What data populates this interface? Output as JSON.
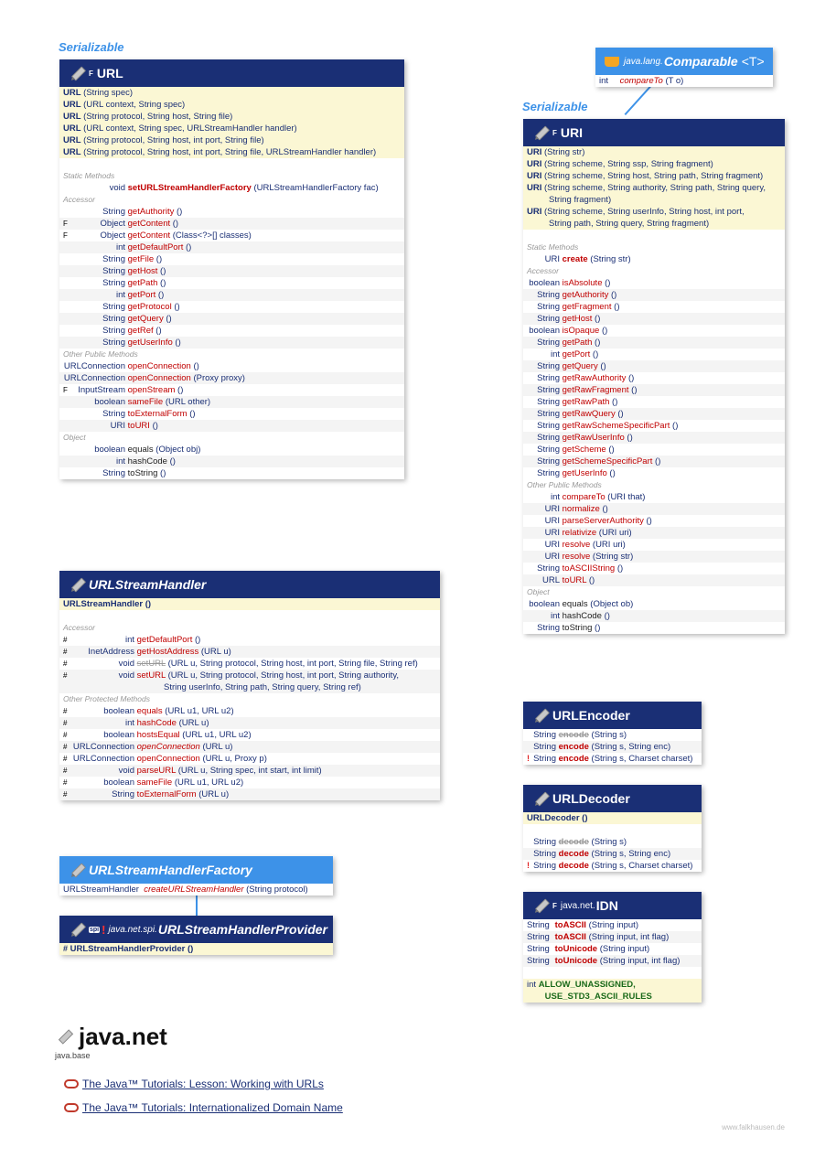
{
  "serializable_label": "Serializable",
  "url": {
    "mod": "F",
    "name": "URL",
    "ctors": [
      [
        "URL",
        "(String spec)"
      ],
      [
        "URL",
        "(URL context, String spec)"
      ],
      [
        "URL",
        "(String protocol, String host, String file)"
      ],
      [
        "URL",
        "(URL context, String spec, URLStreamHandler handler)"
      ],
      [
        "URL",
        "(String protocol, String host, int port, String file)"
      ],
      [
        "URL",
        "(String protocol, String host, int port, String file, URLStreamHandler handler)"
      ]
    ],
    "sections": [
      {
        "title": "Static Methods",
        "rows": [
          [
            "",
            "void",
            "setURLStreamHandlerFactory",
            "(URLStreamHandlerFactory fac)"
          ]
        ]
      },
      {
        "title": "Accessor",
        "rows": [
          [
            "",
            "String",
            "getAuthority",
            "()"
          ],
          [
            "F",
            "Object",
            "getContent",
            "()"
          ],
          [
            "F",
            "Object",
            "getContent",
            "(Class<?>[] classes)"
          ],
          [
            "",
            "int",
            "getDefaultPort",
            "()"
          ],
          [
            "",
            "String",
            "getFile",
            "()"
          ],
          [
            "",
            "String",
            "getHost",
            "()"
          ],
          [
            "",
            "String",
            "getPath",
            "()"
          ],
          [
            "",
            "int",
            "getPort",
            "()"
          ],
          [
            "",
            "String",
            "getProtocol",
            "()"
          ],
          [
            "",
            "String",
            "getQuery",
            "()"
          ],
          [
            "",
            "String",
            "getRef",
            "()"
          ],
          [
            "",
            "String",
            "getUserInfo",
            "()"
          ]
        ]
      },
      {
        "title": "Other Public Methods",
        "rows": [
          [
            "",
            "URLConnection",
            "openConnection",
            "()"
          ],
          [
            "",
            "URLConnection",
            "openConnection",
            "(Proxy proxy)"
          ],
          [
            "F",
            "InputStream",
            "openStream",
            "()"
          ],
          [
            "",
            "boolean",
            "sameFile",
            "(URL other)"
          ],
          [
            "",
            "String",
            "toExternalForm",
            "()"
          ],
          [
            "",
            "URI",
            "toURI",
            "()"
          ]
        ]
      },
      {
        "title": "Object",
        "rows": [
          [
            "",
            "boolean",
            "equals",
            "(Object obj)"
          ],
          [
            "",
            "int",
            "hashCode",
            "()"
          ],
          [
            "",
            "String",
            "toString",
            "()"
          ]
        ]
      }
    ]
  },
  "comparable": {
    "pkg": "java.lang.",
    "name": "Comparable",
    "gen": "<T>",
    "row": [
      "int",
      "compareTo",
      "(T o)"
    ]
  },
  "uri": {
    "mod": "F",
    "name": "URI",
    "ctors": [
      [
        "URI",
        "(String str)"
      ],
      [
        "URI",
        "(String scheme, String ssp, String fragment)"
      ],
      [
        "URI",
        "(String scheme, String host, String path, String fragment)"
      ],
      [
        "URI",
        "(String scheme, String authority, String path, String query,",
        "String fragment)"
      ],
      [
        "URI",
        "(String scheme, String userInfo, String host, int port,",
        "String path, String query, String fragment)"
      ]
    ],
    "sections": [
      {
        "title": "Static Methods",
        "rows": [
          [
            "URI",
            "create",
            "(String str)"
          ]
        ]
      },
      {
        "title": "Accessor",
        "rows": [
          [
            "boolean",
            "isAbsolute",
            "()"
          ],
          [
            "String",
            "getAuthority",
            "()"
          ],
          [
            "String",
            "getFragment",
            "()"
          ],
          [
            "String",
            "getHost",
            "()"
          ],
          [
            "boolean",
            "isOpaque",
            "()"
          ],
          [
            "String",
            "getPath",
            "()"
          ],
          [
            "int",
            "getPort",
            "()"
          ],
          [
            "String",
            "getQuery",
            "()"
          ],
          [
            "String",
            "getRawAuthority",
            "()"
          ],
          [
            "String",
            "getRawFragment",
            "()"
          ],
          [
            "String",
            "getRawPath",
            "()"
          ],
          [
            "String",
            "getRawQuery",
            "()"
          ],
          [
            "String",
            "getRawSchemeSpecificPart",
            "()"
          ],
          [
            "String",
            "getRawUserInfo",
            "()"
          ],
          [
            "String",
            "getScheme",
            "()"
          ],
          [
            "String",
            "getSchemeSpecificPart",
            "()"
          ],
          [
            "String",
            "getUserInfo",
            "()"
          ]
        ]
      },
      {
        "title": "Other Public Methods",
        "rows": [
          [
            "int",
            "compareTo",
            "(URI that)"
          ],
          [
            "URI",
            "normalize",
            "()"
          ],
          [
            "URI",
            "parseServerAuthority",
            "()"
          ],
          [
            "URI",
            "relativize",
            "(URI uri)"
          ],
          [
            "URI",
            "resolve",
            "(URI uri)"
          ],
          [
            "URI",
            "resolve",
            "(String str)"
          ],
          [
            "String",
            "toASCIIString",
            "()"
          ],
          [
            "URL",
            "toURL",
            "()"
          ]
        ]
      },
      {
        "title": "Object",
        "rows": [
          [
            "boolean",
            "equals",
            "(Object ob)"
          ],
          [
            "int",
            "hashCode",
            "()"
          ],
          [
            "String",
            "toString",
            "()"
          ]
        ]
      }
    ]
  },
  "handler": {
    "name": "URLStreamHandler",
    "ctor": "URLStreamHandler ()",
    "sections": [
      {
        "title": "Accessor",
        "rows": [
          [
            "#",
            "int",
            "getDefaultPort",
            "()",
            ""
          ],
          [
            "#",
            "InetAddress",
            "getHostAddress",
            "(URL u)",
            ""
          ],
          [
            "#",
            "void",
            "setURL",
            "(URL u, String protocol, String host, int port, String file, String ref)",
            ""
          ],
          [
            "#",
            "void",
            "setURL",
            "(URL u, String protocol, String host, int port, String authority,",
            "String userInfo, String path, String query, String ref)"
          ]
        ]
      },
      {
        "title": "Other Protected Methods",
        "rows": [
          [
            "#",
            "boolean",
            "equals",
            "(URL u1, URL u2)",
            ""
          ],
          [
            "#",
            "int",
            "hashCode",
            "(URL u)",
            ""
          ],
          [
            "#",
            "boolean",
            "hostsEqual",
            "(URL u1, URL u2)",
            ""
          ],
          [
            "#",
            "URLConnection",
            "openConnection",
            "(URL u)",
            ""
          ],
          [
            "#",
            "URLConnection",
            "openConnection",
            "(URL u, Proxy p)",
            ""
          ],
          [
            "#",
            "void",
            "parseURL",
            "(URL u, String spec, int start, int limit)",
            ""
          ],
          [
            "#",
            "boolean",
            "sameFile",
            "(URL u1, URL u2)",
            ""
          ],
          [
            "#",
            "String",
            "toExternalForm",
            "(URL u)",
            ""
          ]
        ]
      }
    ]
  },
  "factory": {
    "name": "URLStreamHandlerFactory",
    "row": [
      "URLStreamHandler",
      "createURLStreamHandler",
      "(String protocol)"
    ]
  },
  "provider": {
    "spi": "spi",
    "pkg": "java.net.spi.",
    "name": "URLStreamHandlerProvider",
    "ctor": "URLStreamHandlerProvider ()"
  },
  "encoder": {
    "name": "URLEncoder",
    "rows": [
      [
        "",
        "String",
        "encode",
        "(String s)"
      ],
      [
        "",
        "String",
        "encode",
        "(String s, String enc)"
      ],
      [
        "!",
        "String",
        "encode",
        "(String s, Charset charset)"
      ]
    ]
  },
  "decoder": {
    "name": "URLDecoder",
    "ctor": "URLDecoder ()",
    "rows": [
      [
        "",
        "String",
        "decode",
        "(String s)"
      ],
      [
        "",
        "String",
        "decode",
        "(String s, String enc)"
      ],
      [
        "!",
        "String",
        "decode",
        "(String s, Charset charset)"
      ]
    ]
  },
  "idn": {
    "mod": "F",
    "pkg": "java.net.",
    "name": "IDN",
    "rows": [
      [
        "String",
        "toASCII",
        "(String input)"
      ],
      [
        "String",
        "toASCII",
        "(String input, int flag)"
      ],
      [
        "String",
        "toUnicode",
        "(String input)"
      ],
      [
        "String",
        "toUnicode",
        "(String input, int flag)"
      ]
    ],
    "fields_type": "int",
    "fields": [
      "ALLOW_UNASSIGNED,",
      "USE_STD3_ASCII_RULES"
    ]
  },
  "package": {
    "name": "java.net",
    "module": "java.base"
  },
  "links": [
    "The Java™ Tutorials: Lesson: Working with URLs",
    "The Java™ Tutorials: Internationalized Domain Name"
  ],
  "footer": "www.falkhausen.de"
}
